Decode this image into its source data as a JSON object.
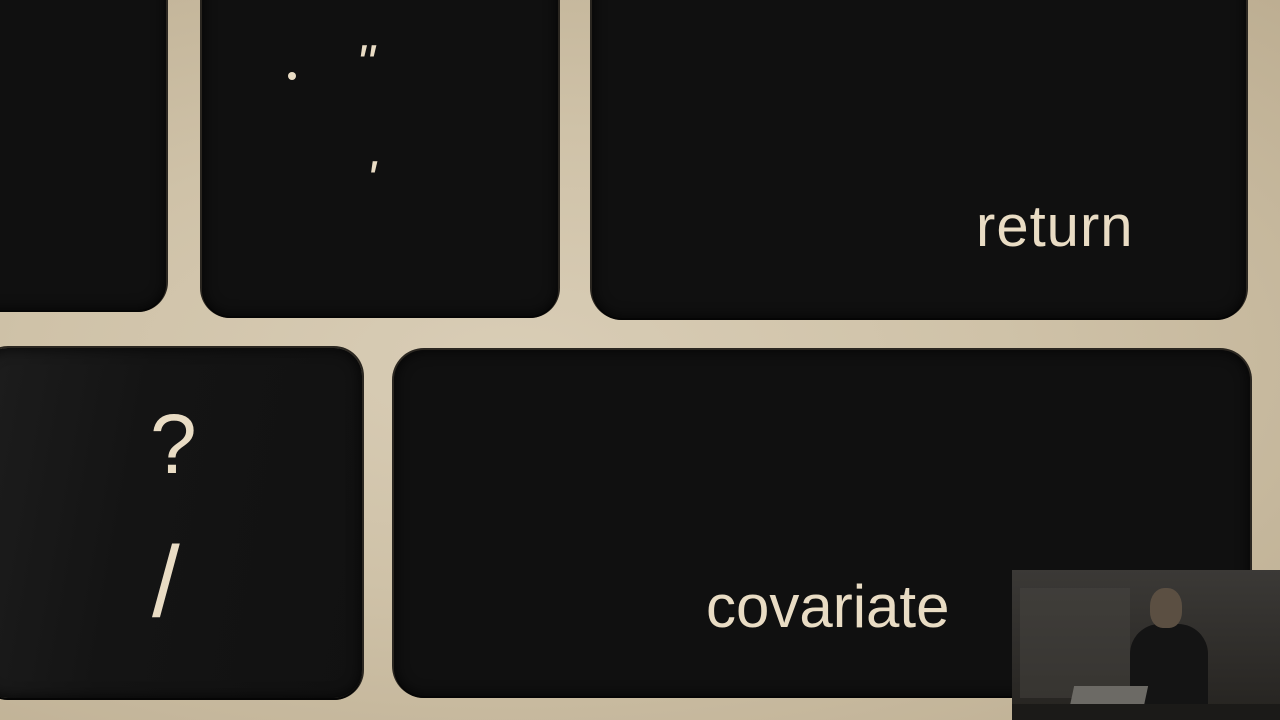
{
  "keys": {
    "quote_key": {
      "upper": "\"",
      "lower": "'"
    },
    "return_key": {
      "label": "return"
    },
    "slash_key": {
      "upper": "?",
      "lower": "/"
    },
    "shift_key": {
      "label": "covariate"
    }
  },
  "inset_video": {
    "content": "presenter-webcam"
  },
  "colors": {
    "keycap": "#101010",
    "key_label": "#e9dcc4",
    "keyboard_frame": "#cfc2a8"
  }
}
